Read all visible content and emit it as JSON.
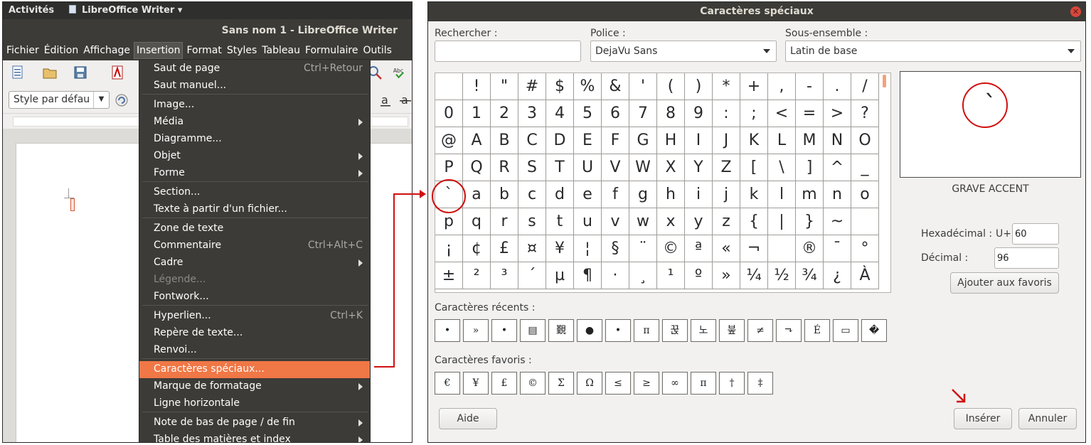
{
  "topbar": {
    "activities": "Activités",
    "app": "LibreOffice Writer ▾"
  },
  "window": {
    "title": "Sans nom 1 - LibreOffice Writer"
  },
  "menubar": [
    "Fichier",
    "Édition",
    "Affichage",
    "Insertion",
    "Format",
    "Styles",
    "Tableau",
    "Formulaire",
    "Outils"
  ],
  "toolbar": {
    "style": "Style par défau"
  },
  "insert_menu": [
    {
      "label": "Saut de page",
      "shortcut": "Ctrl+Retour"
    },
    {
      "label": "Saut manuel..."
    },
    {
      "label": "Image..."
    },
    {
      "label": "Média",
      "submenu": true
    },
    {
      "label": "Diagramme..."
    },
    {
      "label": "Objet",
      "submenu": true
    },
    {
      "label": "Forme",
      "submenu": true
    },
    {
      "label": "Section..."
    },
    {
      "label": "Texte à partir d'un fichier..."
    },
    {
      "label": "Zone de texte"
    },
    {
      "label": "Commentaire",
      "shortcut": "Ctrl+Alt+C"
    },
    {
      "label": "Cadre",
      "submenu": true
    },
    {
      "label": "Légende...",
      "disabled": true
    },
    {
      "label": "Fontwork..."
    },
    {
      "label": "Hyperlien...",
      "shortcut": "Ctrl+K"
    },
    {
      "label": "Repère de texte..."
    },
    {
      "label": "Renvoi..."
    },
    {
      "label": "Caractères spéciaux...",
      "highlighted": true
    },
    {
      "label": "Marque de formatage",
      "submenu": true
    },
    {
      "label": "Ligne horizontale"
    },
    {
      "label": "Note de bas de page / de fin",
      "submenu": true
    },
    {
      "label": "Table des matières et index",
      "submenu": true
    }
  ],
  "dialog": {
    "title": "Caractères spéciaux",
    "search_label": "Rechercher :",
    "search_value": "",
    "font_label": "Police :",
    "font_value": "DejaVu Sans",
    "subset_label": "Sous-ensemble :",
    "subset_value": "Latin de base",
    "grid": [
      [
        " ",
        "!",
        "\"",
        "#",
        "$",
        "%",
        "&",
        "'",
        "(",
        ")",
        "*",
        "+",
        ",",
        "-",
        ".",
        "/"
      ],
      [
        "0",
        "1",
        "2",
        "3",
        "4",
        "5",
        "6",
        "7",
        "8",
        "9",
        ":",
        ";",
        "<",
        "=",
        ">",
        "?"
      ],
      [
        "@",
        "A",
        "B",
        "C",
        "D",
        "E",
        "F",
        "G",
        "H",
        "I",
        "J",
        "K",
        "L",
        "M",
        "N",
        "O"
      ],
      [
        "P",
        "Q",
        "R",
        "S",
        "T",
        "U",
        "V",
        "W",
        "X",
        "Y",
        "Z",
        "[",
        "\\",
        "]",
        "^",
        "_"
      ],
      [
        "`",
        "a",
        "b",
        "c",
        "d",
        "e",
        "f",
        "g",
        "h",
        "i",
        "j",
        "k",
        "l",
        "m",
        "n",
        "o"
      ],
      [
        "p",
        "q",
        "r",
        "s",
        "t",
        "u",
        "v",
        "w",
        "x",
        "y",
        "z",
        "{",
        "|",
        "}",
        "~",
        " "
      ],
      [
        "¡",
        "¢",
        "£",
        "¤",
        "¥",
        "¦",
        "§",
        "¨",
        "©",
        "ª",
        "«",
        "¬",
        " ",
        "®",
        "¯",
        "°"
      ],
      [
        "±",
        "²",
        "³",
        "´",
        "µ",
        "¶",
        "·",
        "¸",
        "¹",
        "º",
        "»",
        "¼",
        "½",
        "¾",
        "¿",
        "À"
      ]
    ],
    "preview_char": "`",
    "char_name": "GRAVE ACCENT",
    "hex_label": "Hexadécimal :",
    "hex_prefix": "U+",
    "hex_value": "60",
    "dec_label": "Décimal :",
    "dec_value": "96",
    "add_fav_label": "Ajouter aux favoris",
    "recent_label": "Caractères récents :",
    "recent": [
      "•",
      "»",
      "•",
      "▤",
      "覲",
      "●",
      "•",
      "π",
      "꾽",
      "노",
      "붚",
      "≠",
      "⬎",
      "É",
      "▭",
      "�"
    ],
    "favorites_label": "Caractères favoris :",
    "favorites": [
      "€",
      "¥",
      "£",
      "©",
      "Σ",
      "Ω",
      "≤",
      "≥",
      "∞",
      "π",
      "†",
      "‡"
    ],
    "help_label": "Aide",
    "insert_label": "Insérer",
    "cancel_label": "Annuler"
  },
  "colors": {
    "accent": "#f07746",
    "annotation": "#d01010",
    "titlebar": "#3c3b37"
  }
}
